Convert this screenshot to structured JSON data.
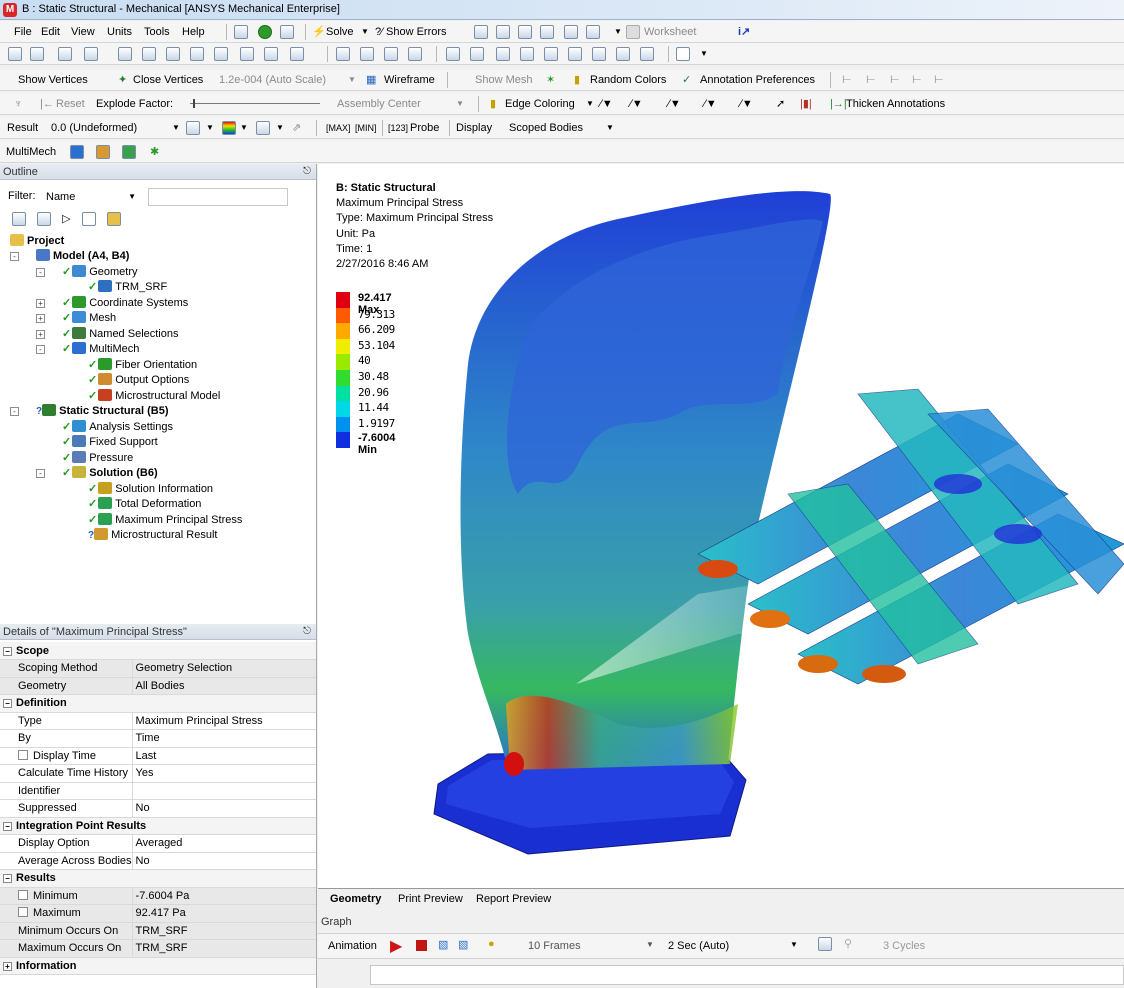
{
  "title": "B : Static Structural - Mechanical [ANSYS Mechanical Enterprise]",
  "menu": [
    "File",
    "Edit",
    "View",
    "Units",
    "Tools",
    "Help"
  ],
  "toolbar1": {
    "solve": "Solve",
    "show_errors": "?⁄ Show Errors",
    "worksheet": "Worksheet"
  },
  "toolbar3": {
    "show_vertices": "Show Vertices",
    "close_vertices": "Close Vertices",
    "scale": "1.2e-004 (Auto Scale)",
    "wireframe": "Wireframe",
    "show_mesh": "Show Mesh",
    "random_colors": "Random Colors",
    "annotation_prefs": "Annotation Preferences"
  },
  "toolbar4": {
    "reset": "Reset",
    "explode_factor": "Explode Factor:",
    "assembly_center": "Assembly Center",
    "edge_coloring": "Edge Coloring",
    "thicken": "Thicken Annotations"
  },
  "toolbar5": {
    "result_label": "Result",
    "result_value": "0.0 (Undeformed)",
    "probe": "Probe",
    "display_label": "Display",
    "display_value": "Scoped Bodies"
  },
  "toolbar6": {
    "multimech": "MultiMech"
  },
  "outline": {
    "header": "Outline",
    "filter_label": "Filter:",
    "filter_value": "Name",
    "nodes": [
      {
        "label": "Project",
        "bold": true
      },
      {
        "label": "Model (A4, B4)",
        "bold": true
      },
      {
        "label": "Geometry"
      },
      {
        "label": "TRM_SRF"
      },
      {
        "label": "Coordinate Systems"
      },
      {
        "label": "Mesh"
      },
      {
        "label": "Named Selections"
      },
      {
        "label": "MultiMech"
      },
      {
        "label": "Fiber Orientation"
      },
      {
        "label": "Output Options"
      },
      {
        "label": "Microstructural Model"
      },
      {
        "label": "Static Structural (B5)",
        "bold": true
      },
      {
        "label": "Analysis Settings"
      },
      {
        "label": "Fixed Support"
      },
      {
        "label": "Pressure"
      },
      {
        "label": "Solution (B6)",
        "bold": true
      },
      {
        "label": "Solution Information"
      },
      {
        "label": "Total Deformation"
      },
      {
        "label": "Maximum Principal Stress"
      },
      {
        "label": "Microstructural Result"
      }
    ]
  },
  "details": {
    "header": "Details of \"Maximum Principal Stress\"",
    "rows": [
      {
        "g": "Scope"
      },
      {
        "k": "Scoping Method",
        "v": "Geometry Selection",
        "alt": true
      },
      {
        "k": "Geometry",
        "v": "All Bodies",
        "alt": true
      },
      {
        "g": "Definition"
      },
      {
        "k": "Type",
        "v": "Maximum Principal Stress"
      },
      {
        "k": "By",
        "v": "Time"
      },
      {
        "k": "Display Time",
        "v": "Last",
        "cb": true
      },
      {
        "k": "Calculate Time History",
        "v": "Yes"
      },
      {
        "k": "Identifier",
        "v": ""
      },
      {
        "k": "Suppressed",
        "v": "No"
      },
      {
        "g": "Integration Point Results"
      },
      {
        "k": "Display Option",
        "v": "Averaged"
      },
      {
        "k": "Average Across Bodies",
        "v": "No"
      },
      {
        "g": "Results"
      },
      {
        "k": "Minimum",
        "v": "-7.6004 Pa",
        "cb": true,
        "alt": true
      },
      {
        "k": "Maximum",
        "v": "92.417 Pa",
        "cb": true,
        "alt": true
      },
      {
        "k": "Minimum Occurs On",
        "v": "TRM_SRF",
        "alt": true
      },
      {
        "k": "Maximum Occurs On",
        "v": "TRM_SRF",
        "alt": true
      },
      {
        "g": "Information",
        "plus": true
      }
    ]
  },
  "viewport": {
    "info": [
      "B: Static Structural",
      "Maximum Principal Stress",
      "Type: Maximum Principal Stress",
      "Unit: Pa",
      "Time: 1",
      "2/27/2016 8:46 AM"
    ],
    "legend": [
      {
        "label": "92.417 Max",
        "color": "#e0000f"
      },
      {
        "label": "79.313",
        "color": "#ff5a00"
      },
      {
        "label": "66.209",
        "color": "#ffaa00"
      },
      {
        "label": "53.104",
        "color": "#f0ee00"
      },
      {
        "label": "40",
        "color": "#9aea00"
      },
      {
        "label": "30.48",
        "color": "#2fdc2f"
      },
      {
        "label": "20.96",
        "color": "#00e0a0"
      },
      {
        "label": "11.44",
        "color": "#00d8e8"
      },
      {
        "label": "1.9197",
        "color": "#0090f0"
      },
      {
        "label": "-7.6004 Min",
        "color": "#1030e0"
      }
    ]
  },
  "tabs": [
    "Geometry",
    "Print Preview",
    "Report Preview"
  ],
  "graph": {
    "header": "Graph",
    "animation": "Animation",
    "frames": "10 Frames",
    "duration": "2 Sec (Auto)",
    "cycles": "3 Cycles"
  }
}
